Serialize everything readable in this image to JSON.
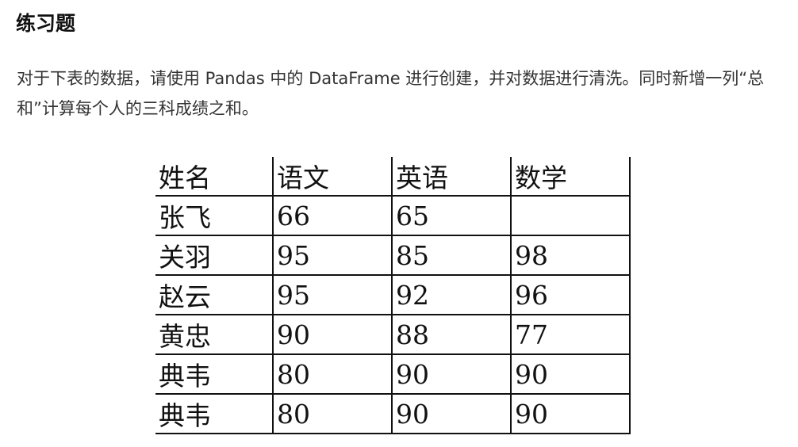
{
  "title": "练习题",
  "paragraph": "对于下表的数据，请使用 Pandas 中的 DataFrame 进行创建，并对数据进行清洗。同时新增一列“总和”计算每个人的三科成绩之和。",
  "table": {
    "headers": [
      "姓名",
      "语文",
      "英语",
      "数学"
    ],
    "rows": [
      [
        "张飞",
        "66",
        "65",
        ""
      ],
      [
        "关羽",
        "95",
        "85",
        "98"
      ],
      [
        "赵云",
        "95",
        "92",
        "96"
      ],
      [
        "黄忠",
        "90",
        "88",
        "77"
      ],
      [
        "典韦",
        "80",
        "90",
        "90"
      ],
      [
        "典韦",
        "80",
        "90",
        "90"
      ]
    ]
  }
}
